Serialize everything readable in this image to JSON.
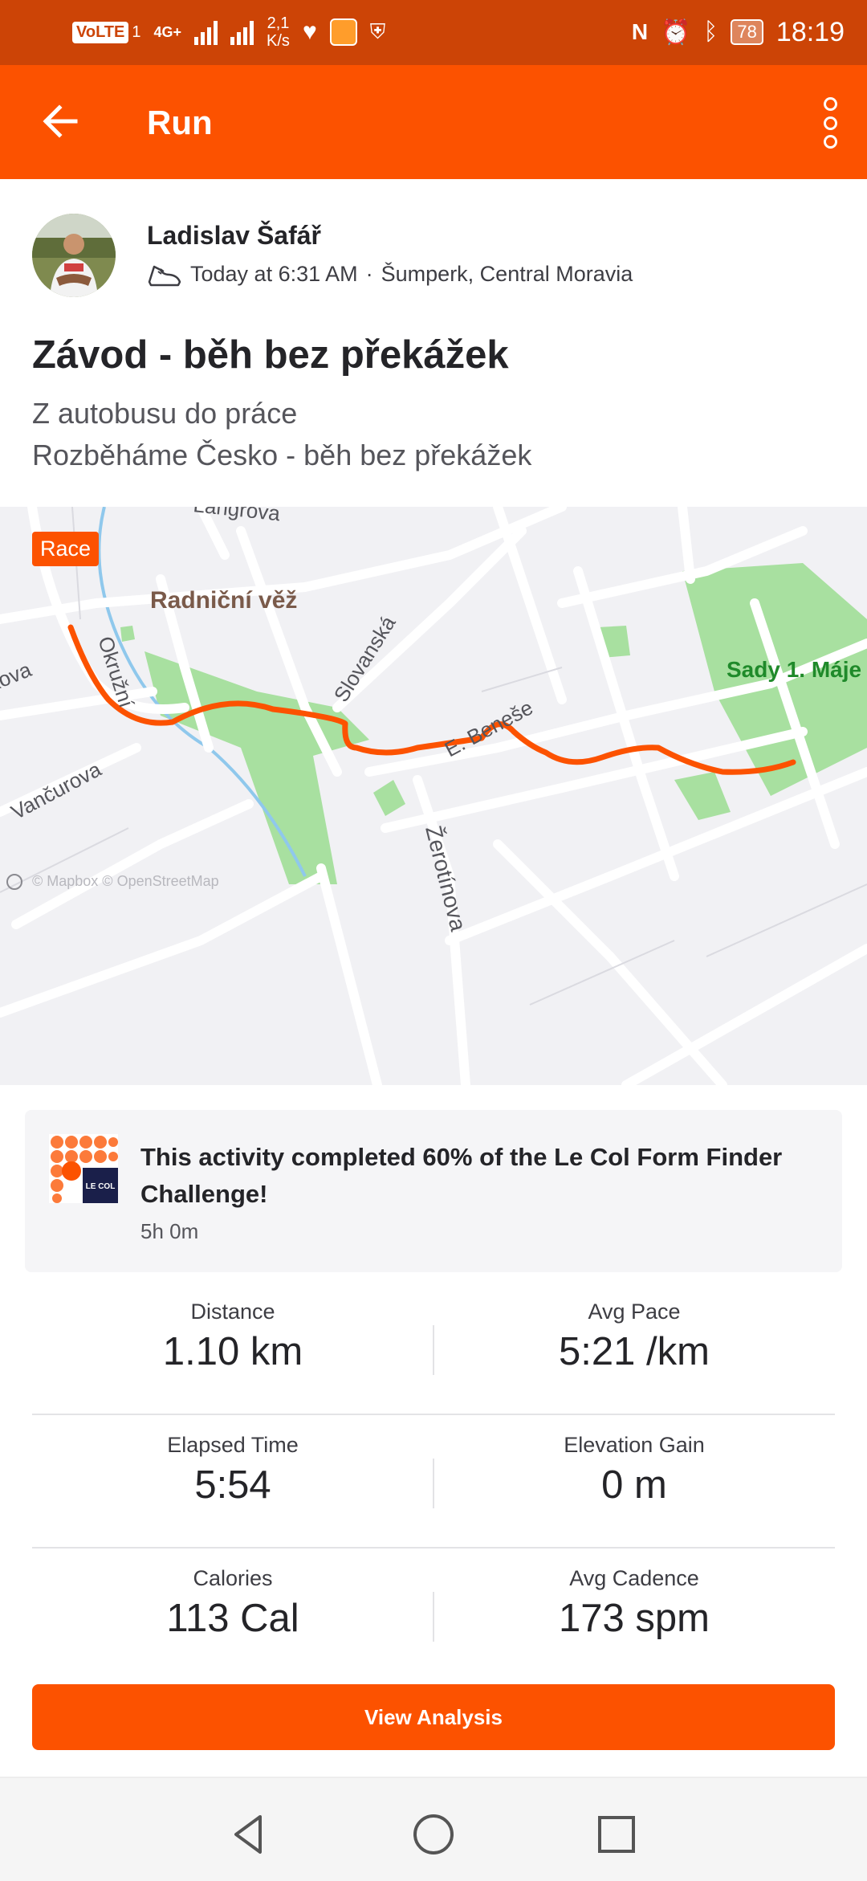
{
  "status_bar": {
    "volte": "VoLTE",
    "sim": "1",
    "network": "4G+",
    "speed_value": "2,1",
    "speed_unit": "K/s",
    "battery": "78",
    "time": "18:19"
  },
  "app_bar": {
    "title": "Run"
  },
  "athlete": {
    "name": "Ladislav Šafář",
    "datetime": "Today at 6:31 AM",
    "separator": "·",
    "location": "Šumperk, Central Moravia"
  },
  "activity": {
    "title": "Závod - běh bez překážek",
    "description_lines": [
      "Z autobusu do práce",
      "Rozběháme Česko - běh bez překážek"
    ]
  },
  "map": {
    "badge": "Race",
    "labels": [
      "Langrova",
      "Radniční věž",
      "Okružní",
      "Slovanská",
      "kova",
      "Vančurova",
      "E. Beneše",
      "Žerotínova",
      "Sady 1. Máje"
    ],
    "attribution": "© Mapbox © OpenStreetMap",
    "route_color": "#fc5200"
  },
  "challenge": {
    "logo_text": "LE COL",
    "text": "This activity completed 60% of the Le Col Form Finder Challenge!",
    "time": "5h 0m"
  },
  "stats": [
    {
      "left": {
        "label": "Distance",
        "value": "1.10 km"
      },
      "right": {
        "label": "Avg Pace",
        "value": "5:21 /km"
      }
    },
    {
      "left": {
        "label": "Elapsed Time",
        "value": "5:54"
      },
      "right": {
        "label": "Elevation Gain",
        "value": "0 m"
      }
    },
    {
      "left": {
        "label": "Calories",
        "value": "113 Cal"
      },
      "right": {
        "label": "Avg Cadence",
        "value": "173 spm"
      }
    }
  ],
  "actions": {
    "view_analysis": "View Analysis"
  },
  "colors": {
    "brand": "#fc5200",
    "status_bar": "#cc4406"
  }
}
